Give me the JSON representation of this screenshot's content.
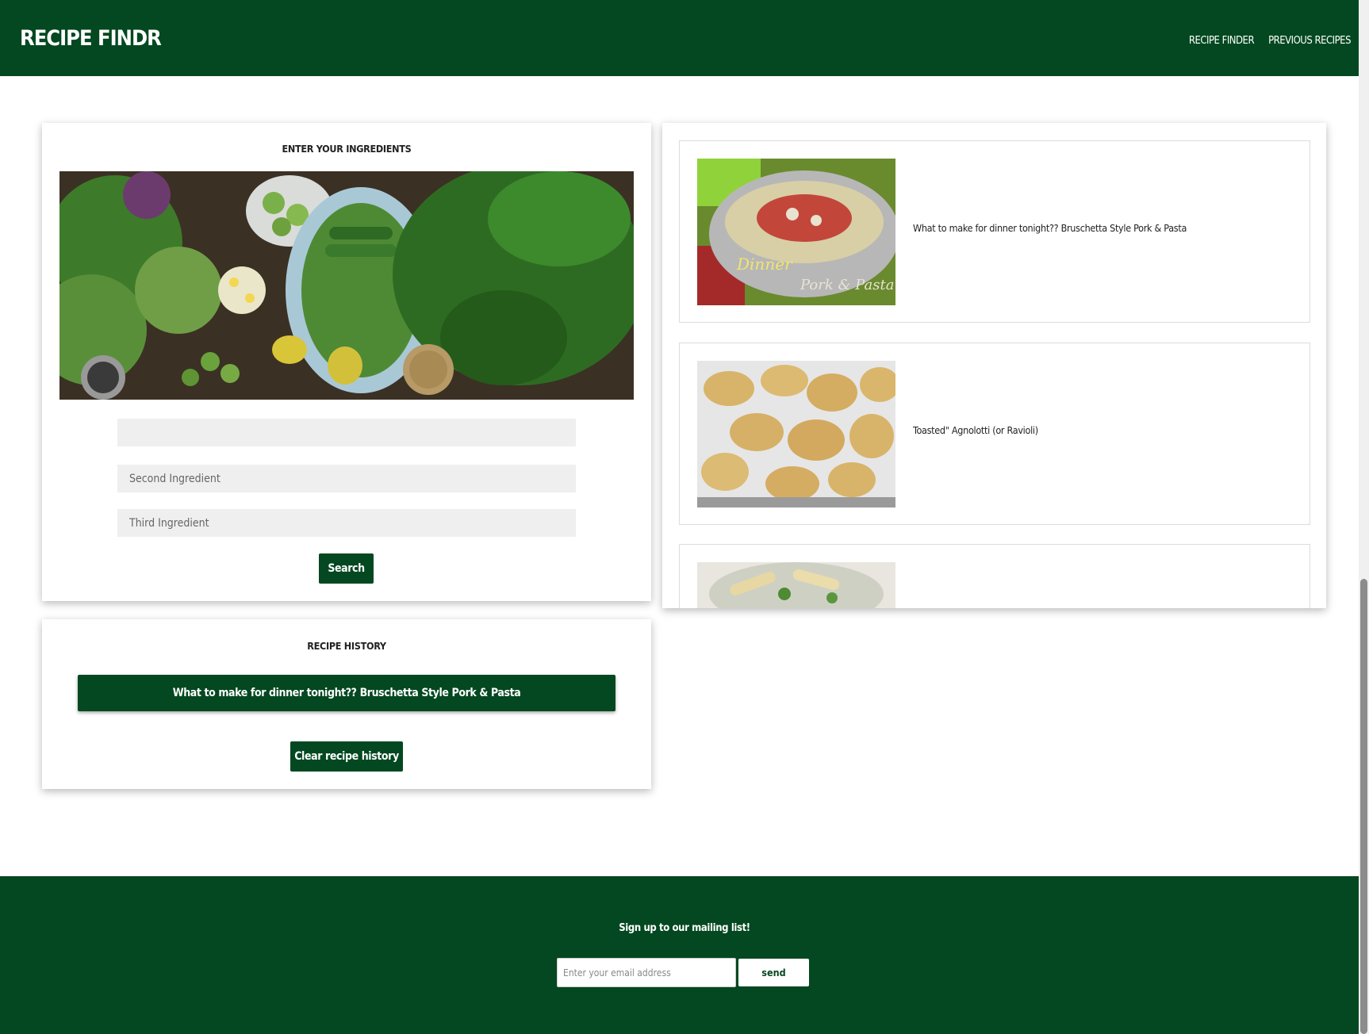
{
  "colors": {
    "brand_green": "#034820",
    "card_background": "#ffffff",
    "input_background": "#efefef"
  },
  "navbar": {
    "brand": "RECIPE FINDR",
    "links": [
      "RECIPE FINDER",
      "PREVIOUS RECIPES"
    ]
  },
  "ingredient_form": {
    "heading": "ENTER YOUR INGREDIENTS",
    "hero_image": "fresh-green-vegetables-photo",
    "fields": [
      {
        "value": "",
        "placeholder": ""
      },
      {
        "value": "",
        "placeholder": "Second Ingredient"
      },
      {
        "value": "",
        "placeholder": "Third Ingredient"
      }
    ],
    "search_label": "Search"
  },
  "history": {
    "heading": "RECIPE HISTORY",
    "items": [
      "What to make for dinner tonight?? Bruschetta Style Pork & Pasta"
    ],
    "clear_label": "Clear recipe history"
  },
  "results": [
    {
      "title": "What to make for dinner tonight?? Bruschetta Style Pork & Pasta",
      "image": "pork-pasta-bowl-photo"
    },
    {
      "title": "Toasted\" Agnolotti (or Ravioli)",
      "image": "toasted-ravioli-photo"
    },
    {
      "title": "",
      "image": "penne-pasta-photo"
    }
  ],
  "footer": {
    "signup_text": "Sign up to our mailing list!",
    "email_placeholder": "Enter your email address",
    "send_label": "send"
  }
}
